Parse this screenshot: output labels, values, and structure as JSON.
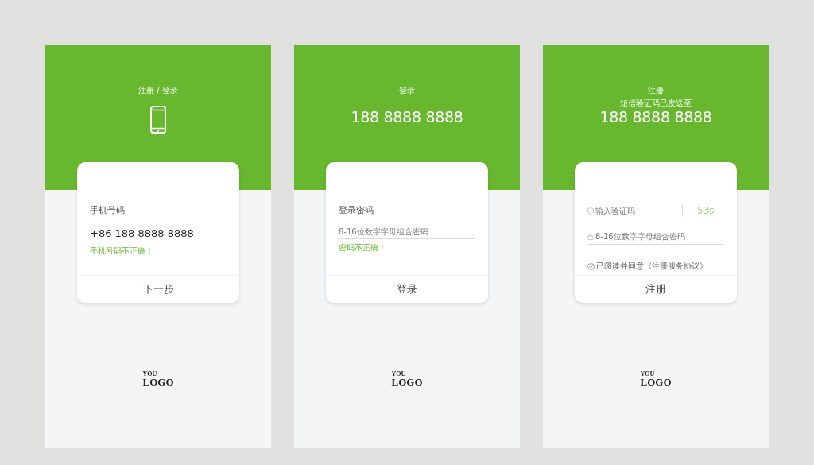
{
  "screens": [
    {
      "title": "注册 / 登录",
      "kind": "icon",
      "items": [
        {
          "kind": "label",
          "text": "手机号码"
        },
        {
          "kind": "value-field",
          "value": "+86 188 8888 8888"
        },
        {
          "kind": "error",
          "text": "手机号码不正确！"
        }
      ],
      "button": "下一步",
      "logo": {
        "top": "YOU",
        "main": "LOGO"
      }
    },
    {
      "title": "登录",
      "kind": "number",
      "number": "188 8888 8888",
      "items": [
        {
          "kind": "label",
          "text": "登录密码"
        },
        {
          "kind": "hint-field",
          "placeholder": "8-16位数字字母组合密码"
        },
        {
          "kind": "error",
          "text": "密码不正确！"
        }
      ],
      "button": "登录",
      "logo": {
        "top": "YOU",
        "main": "LOGO"
      }
    },
    {
      "title": "注册",
      "kind": "number",
      "note": "短信验证码已发送至",
      "number": "188 8888 8888",
      "items": [
        {
          "kind": "code-field",
          "placeholder": "输入验证码",
          "timer": "53s"
        },
        {
          "kind": "lock-field",
          "placeholder": "8-16位数字字母组合密码"
        },
        {
          "kind": "agreement",
          "text": "已阅读并同意《注册服务协议》",
          "checked": true
        }
      ],
      "button": "注册",
      "logo": {
        "top": "YOU",
        "main": "LOGO"
      }
    }
  ]
}
